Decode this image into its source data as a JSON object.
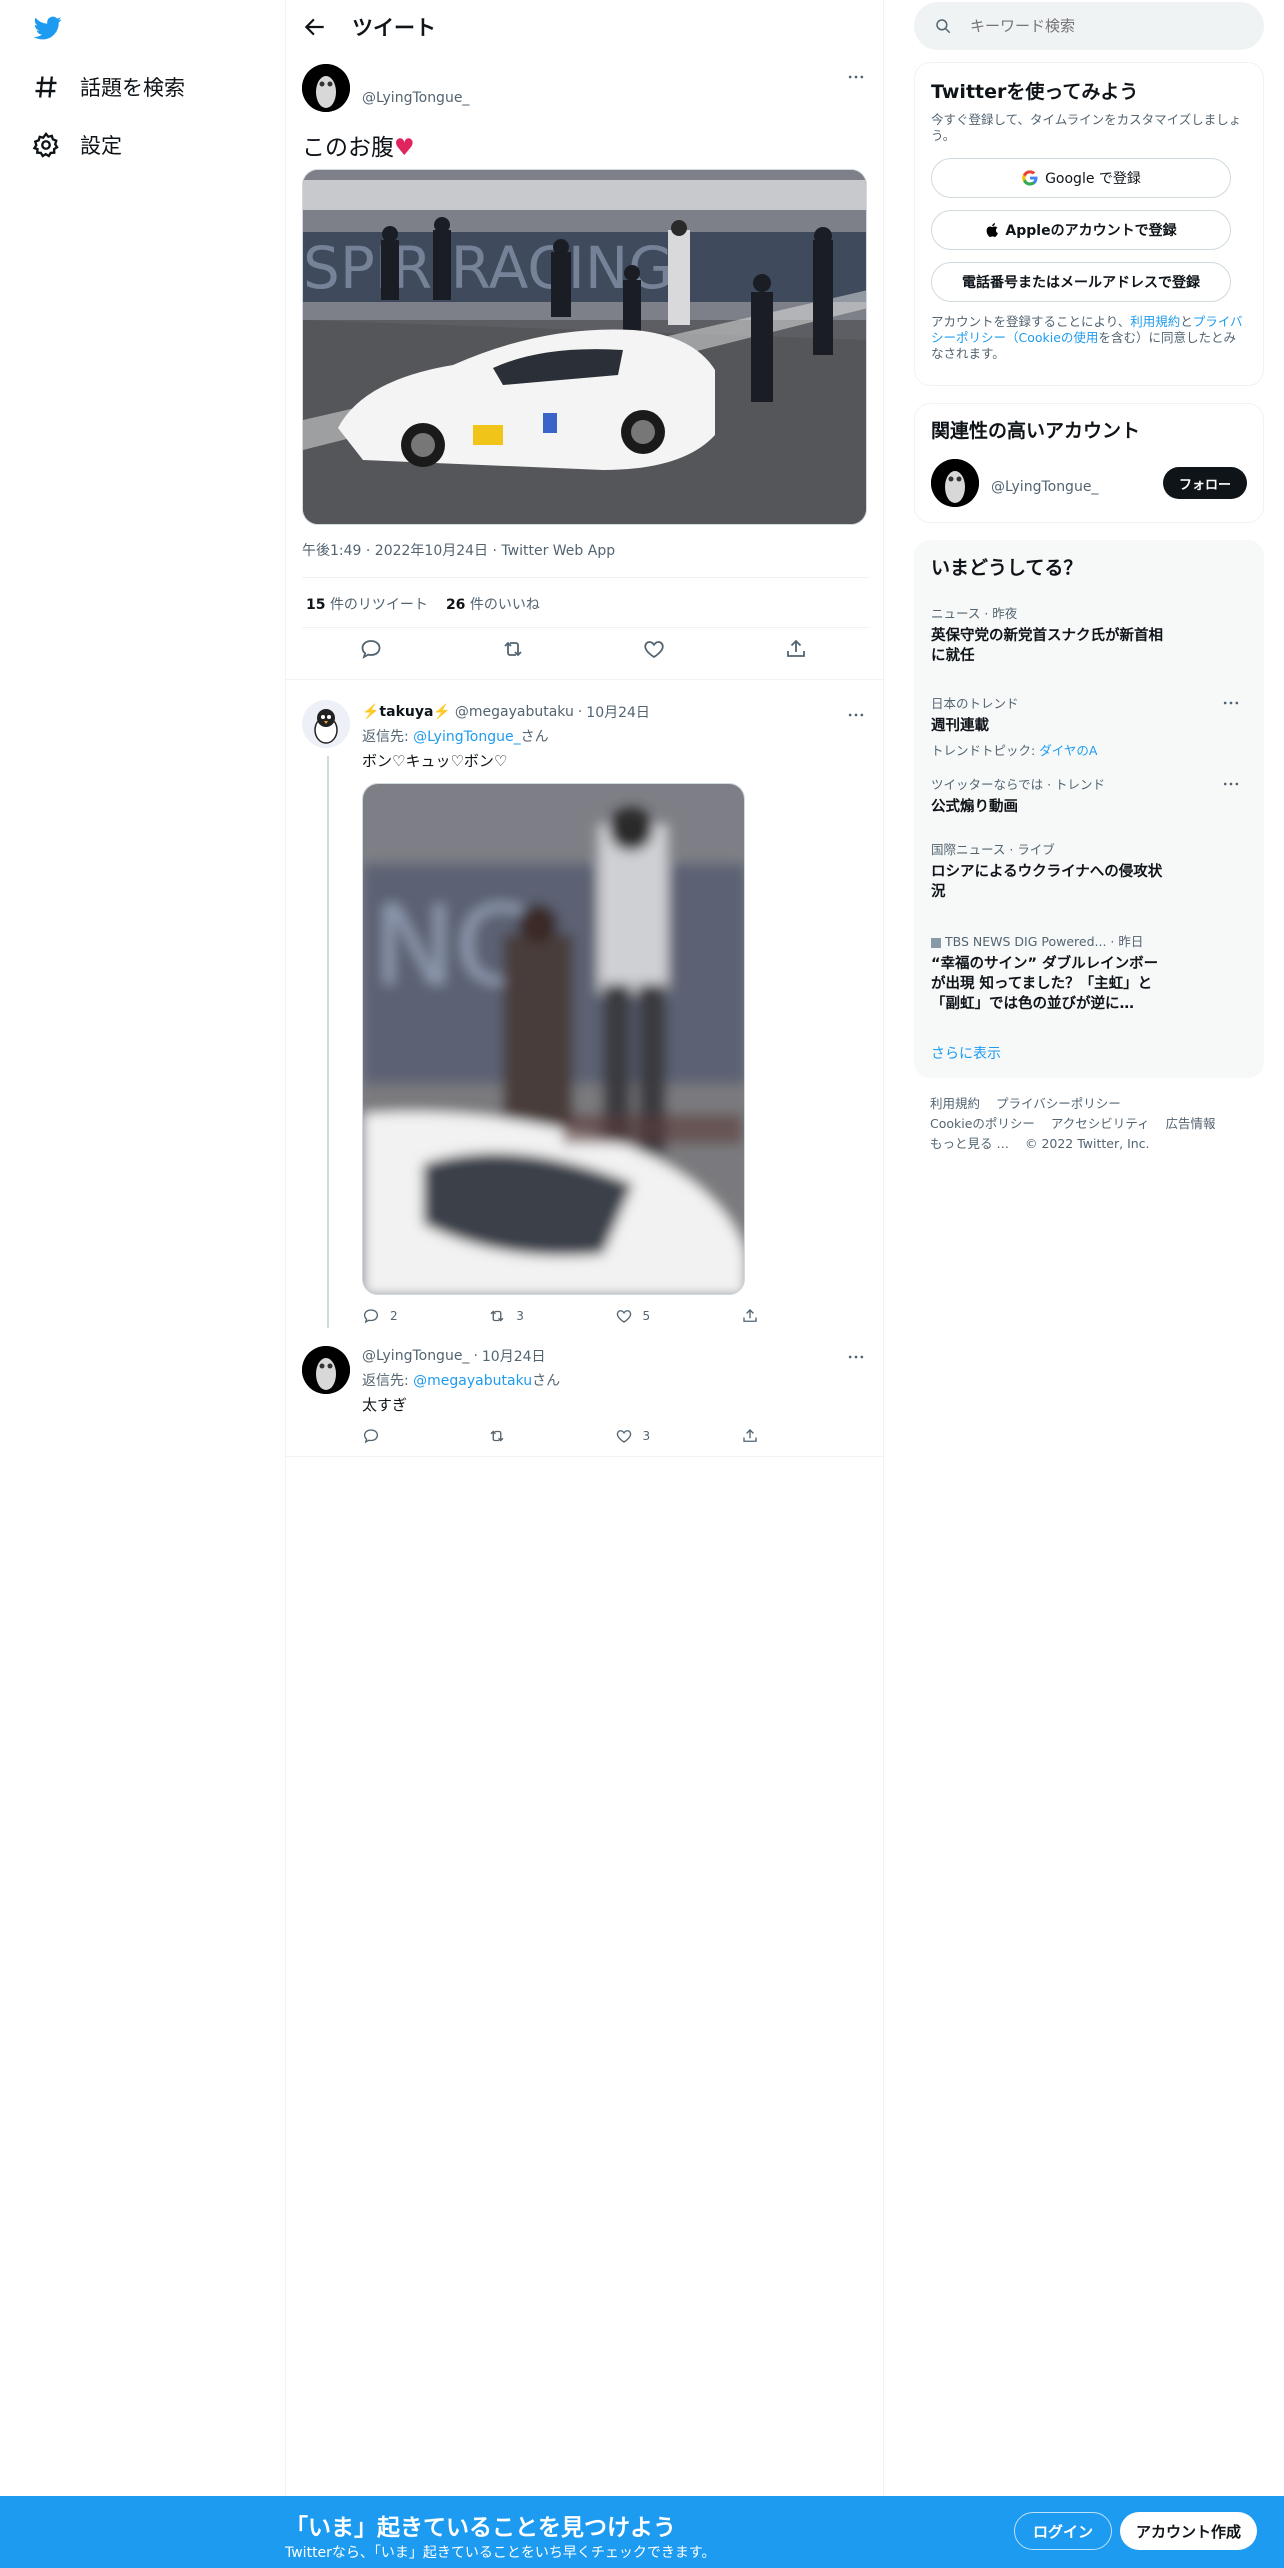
{
  "nav": {
    "items": [
      {
        "label": "話題を検索",
        "icon": "hashtag-icon"
      },
      {
        "label": "設定",
        "icon": "gear-icon"
      }
    ]
  },
  "header": {
    "title": "ツイート"
  },
  "main_tweet": {
    "handle": "@LyingTongue_",
    "text": "このお腹",
    "emoji": "♥",
    "meta": "午後1:49 · 2022年10月24日 · Twitter Web App",
    "retweets_count": "15",
    "retweets_label": "件のリツイート",
    "likes_count": "26",
    "likes_label": "件のいいね"
  },
  "reply1": {
    "name": "⚡️⁣⁣takuya⁣⁣⚡️",
    "handle": "@megayabutaku",
    "dot": "·",
    "date": "10月24日",
    "replying_to_prefix": "返信先: ",
    "replying_to": "@LyingTongue_",
    "replying_to_suffix": "さん",
    "text": "ボン♡キュッ♡ボン♡",
    "replies": "2",
    "retweets": "3",
    "likes": "5"
  },
  "reply2": {
    "handle": "@LyingTongue_",
    "dot": "·",
    "date": "10月24日",
    "replying_to_prefix": "返信先: ",
    "replying_to": "@megayabutaku",
    "replying_to_suffix": "さん",
    "text": "太すぎ",
    "replies": "",
    "retweets": "",
    "likes": "3"
  },
  "search": {
    "placeholder": "キーワード検索"
  },
  "signup": {
    "title": "Twitterを使ってみよう",
    "subtitle": "今すぐ登録して、タイムラインをカスタマイズしましょう。",
    "google": "Google で登録",
    "apple": "Appleのアカウントで登録",
    "phone": "電話番号またはメールアドレスで登録",
    "terms_1": "アカウントを登録することにより、",
    "terms_link1": "利用規約",
    "terms_2": "と",
    "terms_link2": "プライバシーポリシー（Cookieの使用",
    "terms_3": "を含む）に同意したとみなされます。"
  },
  "related": {
    "title": "関連性の高いアカウント",
    "handle": "@LyingTongue_",
    "follow": "フォロー"
  },
  "trends": {
    "title": "いまどうしてる？",
    "items": [
      {
        "context": "ニュース · 昨夜",
        "title": "英保守党の新党首スナク氏が新首相に就任",
        "sub": ""
      },
      {
        "context": "日本のトレンド",
        "title": "週刊連載",
        "sub_prefix": "トレンドトピック: ",
        "sub_link": "ダイヤのA"
      },
      {
        "context": "ツイッターならでは · トレンド",
        "title": "公式煽り動画",
        "sub": ""
      },
      {
        "context": "国際ニュース · ライブ",
        "title": "ロシアによるウクライナへの侵攻状況",
        "sub": ""
      },
      {
        "context": "TBS NEWS DIG Powered... · 昨日",
        "title": "“幸福のサイン” ダブルレインボーが出現 知ってました？「主虹」と「副虹」では色の並びが逆に…",
        "sub": ""
      }
    ],
    "show_more": "さらに表示"
  },
  "footer": {
    "links": [
      "利用規約",
      "プライバシーポリシー",
      "Cookieのポリシー",
      "アクセシビリティ",
      "広告情報",
      "もっと見る …",
      "© 2022 Twitter, Inc."
    ]
  },
  "banner": {
    "title": "「いま」起きていることを見つけよう",
    "subtitle": "Twitterなら、「いま」起きていることをいち早くチェックできます。",
    "login": "ログイン",
    "signup": "アカウント作成"
  },
  "colors": {
    "accent": "#1d9bf0",
    "text": "#0f1419",
    "secondary": "#536471",
    "heart": "#e0245e"
  }
}
